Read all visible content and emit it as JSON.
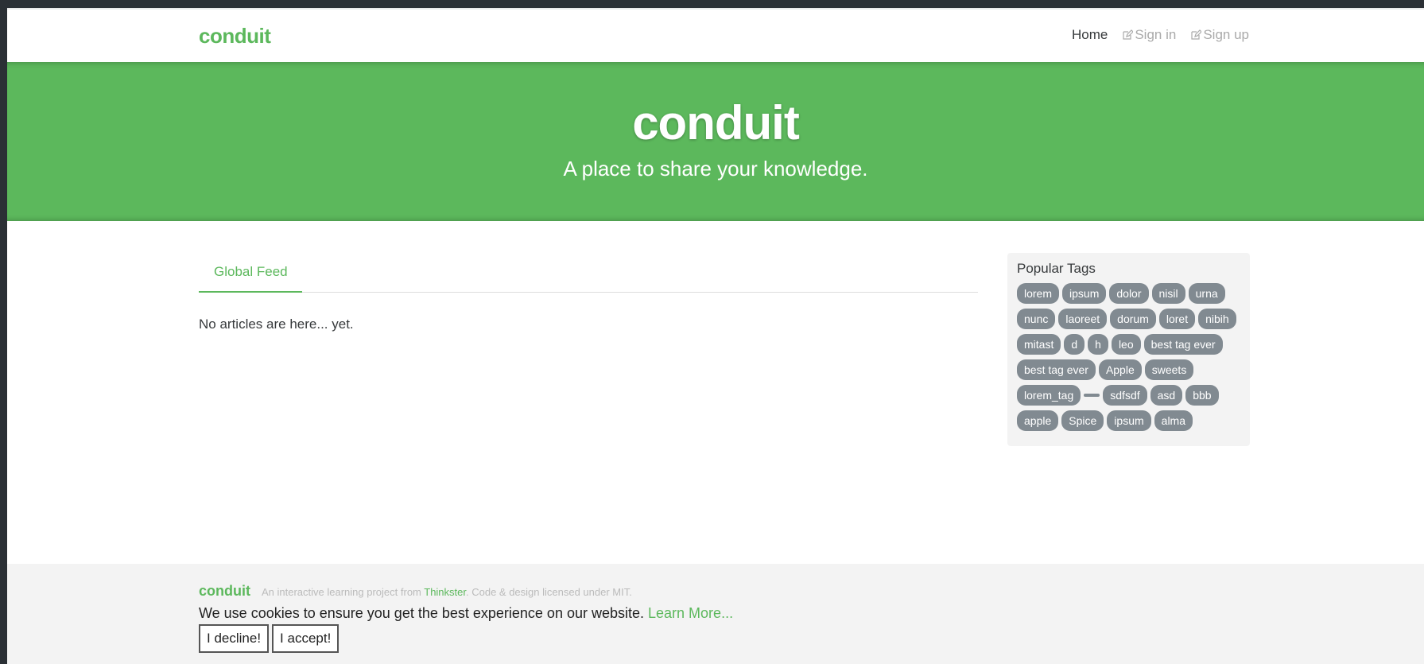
{
  "navbar": {
    "brand": "conduit",
    "links": [
      {
        "label": "Home",
        "active": true,
        "icon": ""
      },
      {
        "label": "Sign in",
        "active": false,
        "icon": "edit-icon"
      },
      {
        "label": "Sign up",
        "active": false,
        "icon": "edit-icon"
      }
    ]
  },
  "banner": {
    "title": "conduit",
    "subtitle": "A place to share your knowledge."
  },
  "feed": {
    "tabs": [
      {
        "label": "Global Feed",
        "active": true
      }
    ],
    "empty_message": "No articles are here... yet."
  },
  "sidebar": {
    "title": "Popular Tags",
    "tags": [
      "lorem",
      "ipsum",
      "dolor",
      "nisil",
      "urna",
      "nunc",
      "laoreet",
      "dorum",
      "loret",
      "nibih",
      "mitast",
      "d",
      "h",
      "leo",
      "best tag ever",
      "best tag ever",
      "Apple",
      "sweets",
      "lorem_tag",
      "",
      "sdfsdf",
      "asd",
      "bbb",
      "apple",
      "Spice",
      "ipsum",
      "alma"
    ]
  },
  "footer": {
    "logo": "conduit",
    "attribution_prefix": "An interactive learning project from ",
    "attribution_link": "Thinkster",
    "attribution_suffix": ". Code & design licensed under MIT."
  },
  "cookie": {
    "message": "We use cookies to ensure you get the best experience on our website. ",
    "learn_more": "Learn More...",
    "decline_label": "I decline!",
    "accept_label": "I accept!"
  },
  "colors": {
    "accent": "#5cb85c",
    "tag_bg": "#818a91",
    "footer_bg": "#f3f3f3"
  }
}
